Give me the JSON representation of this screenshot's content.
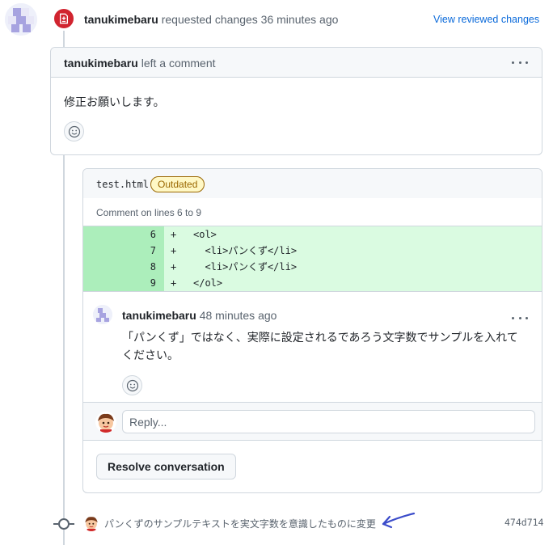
{
  "review": {
    "author": "tanukimebaru",
    "action": "requested changes 36 minutes ago",
    "view_reviewed_label": "View reviewed changes"
  },
  "review_comment": {
    "author": "tanukimebaru",
    "action": "left a comment",
    "body": "修正お願いします。"
  },
  "thread": {
    "file_name": "test.html",
    "badge": "Outdated",
    "lines_label": "Comment on lines 6 to 9",
    "diff": [
      {
        "num": "6",
        "sign": "+",
        "code": "<ol>"
      },
      {
        "num": "7",
        "sign": "+",
        "code": "  <li>パンくず</li>"
      },
      {
        "num": "8",
        "sign": "+",
        "code": "  <li>パンくず</li>"
      },
      {
        "num": "9",
        "sign": "+",
        "code": "</ol>"
      }
    ],
    "comment": {
      "author": "tanukimebaru",
      "time": "48 minutes ago",
      "body": "「パンくず」ではなく、実際に設定されるであろう文字数でサンプルを入れてください。"
    },
    "reply_placeholder": "Reply...",
    "resolve_label": "Resolve conversation"
  },
  "commit": {
    "message": "パンくずのサンプルテキストを実文字数を意識したものに変更",
    "sha": "474d714"
  },
  "colors": {
    "danger": "#d1242f",
    "link": "#0969da",
    "diff_add": "#dafbe1",
    "diff_add_num": "#aceebb",
    "outdated": "#9a6700",
    "arrow": "#3b4cca"
  },
  "icons": {
    "review_badge": "file-diff-icon",
    "reaction": "smiley-icon",
    "more": "kebab-horizontal-icon",
    "commit": "git-commit-icon"
  }
}
